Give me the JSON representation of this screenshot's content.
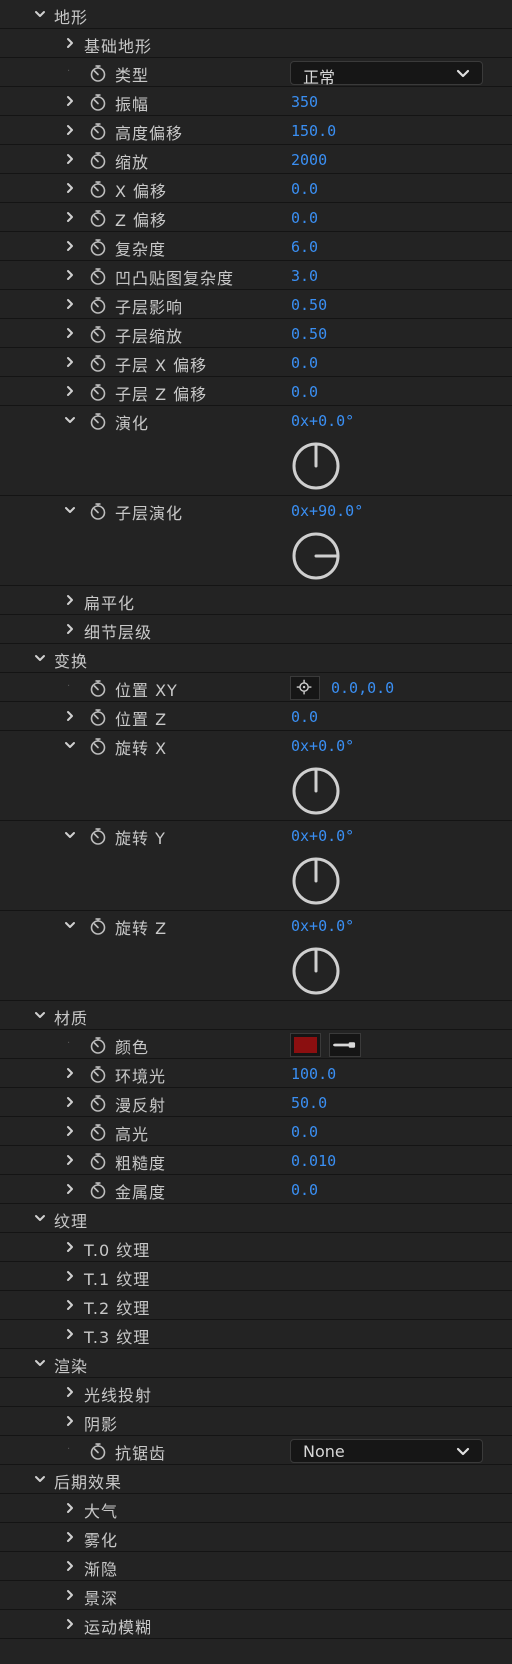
{
  "colors": {
    "accent": "#3a8ff3",
    "material_color": "#8b0f10"
  },
  "terrain": {
    "header": "地形",
    "base_terrain": "基础地形",
    "type_label": "类型",
    "type_value": "正常",
    "amplitude_label": "振幅",
    "amplitude_value": "350",
    "height_offset_label": "高度偏移",
    "height_offset_value": "150.0",
    "scale_label": "缩放",
    "scale_value": "2000",
    "x_offset_label": "X 偏移",
    "x_offset_value": "0.0",
    "z_offset_label": "Z 偏移",
    "z_offset_value": "0.0",
    "complexity_label": "复杂度",
    "complexity_value": "6.0",
    "bump_complexity_label": "凹凸贴图复杂度",
    "bump_complexity_value": "3.0",
    "sublayer_influence_label": "子层影响",
    "sublayer_influence_value": "0.50",
    "sublayer_scale_label": "子层缩放",
    "sublayer_scale_value": "0.50",
    "sublayer_x_offset_label": "子层 X 偏移",
    "sublayer_x_offset_value": "0.0",
    "sublayer_z_offset_label": "子层 Z 偏移",
    "sublayer_z_offset_value": "0.0",
    "evolution_label": "演化",
    "evolution_value": "0x+0.0°",
    "evolution_angle": 0,
    "sublayer_evolution_label": "子层演化",
    "sublayer_evolution_value": "0x+90.0°",
    "sublayer_evolution_angle": 90,
    "flatten": "扁平化",
    "detail_level": "细节层级"
  },
  "transform": {
    "header": "变换",
    "position_xy_label": "位置 XY",
    "position_xy_value": "0.0,0.0",
    "position_z_label": "位置 Z",
    "position_z_value": "0.0",
    "rotation_x_label": "旋转 X",
    "rotation_x_value": "0x+0.0°",
    "rotation_x_angle": 0,
    "rotation_y_label": "旋转 Y",
    "rotation_y_value": "0x+0.0°",
    "rotation_y_angle": 0,
    "rotation_z_label": "旋转 Z",
    "rotation_z_value": "0x+0.0°",
    "rotation_z_angle": 0
  },
  "material": {
    "header": "材质",
    "color_label": "颜色",
    "ambient_label": "环境光",
    "ambient_value": "100.0",
    "diffuse_label": "漫反射",
    "diffuse_value": "50.0",
    "specular_label": "高光",
    "specular_value": "0.0",
    "roughness_label": "粗糙度",
    "roughness_value": "0.010",
    "metalness_label": "金属度",
    "metalness_value": "0.0"
  },
  "texture": {
    "header": "纹理",
    "t0": "T.0 纹理",
    "t1": "T.1 纹理",
    "t2": "T.2 纹理",
    "t3": "T.3 纹理"
  },
  "render": {
    "header": "渲染",
    "raytrace": "光线投射",
    "shadow": "阴影",
    "antialias_label": "抗锯齿",
    "antialias_value": "None"
  },
  "post": {
    "header": "后期效果",
    "atmosphere": "大气",
    "fog": "雾化",
    "fade": "渐隐",
    "dof": "景深",
    "motion_blur": "运动模糊"
  }
}
